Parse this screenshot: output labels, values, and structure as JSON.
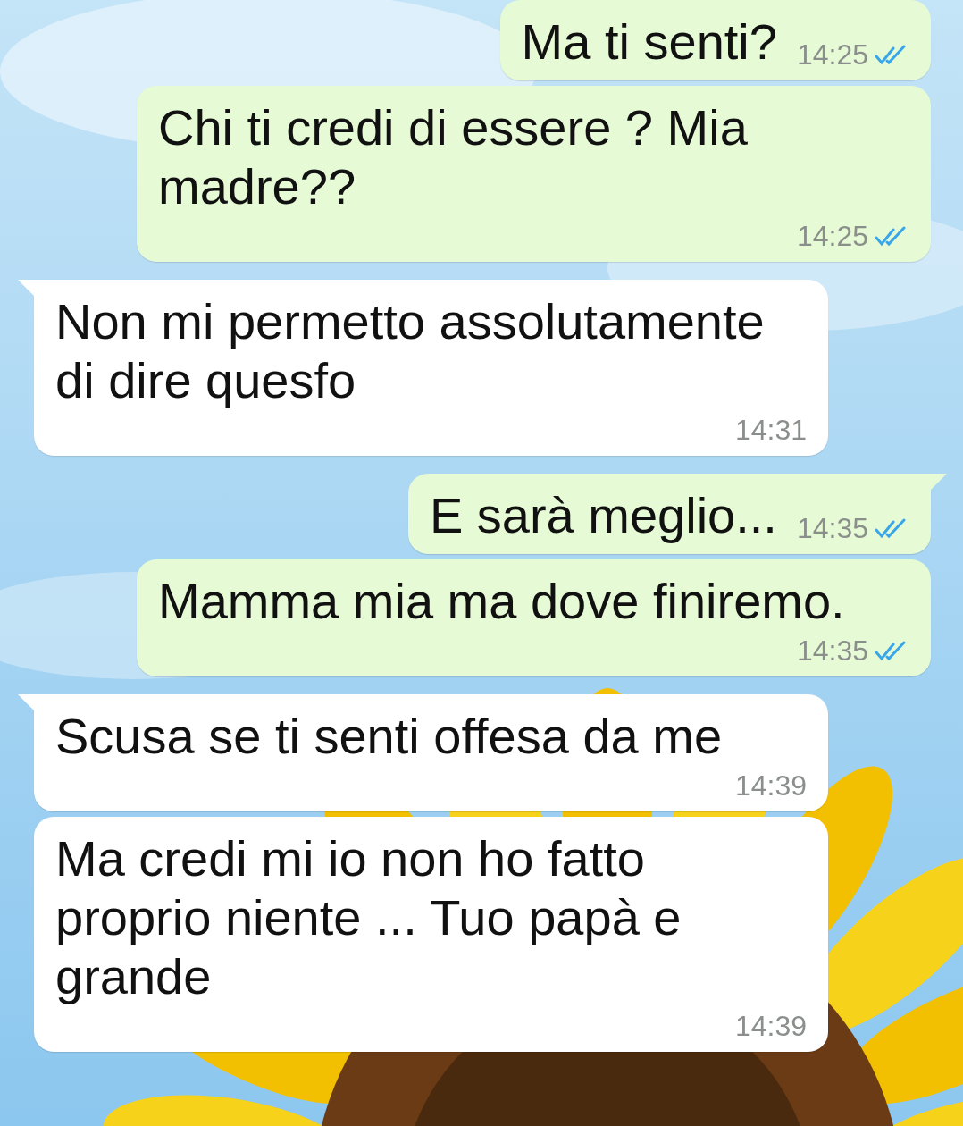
{
  "messages": [
    {
      "kind": "outgoing",
      "text": "Ma ti senti?",
      "time": "14:25",
      "read": true,
      "tail": false
    },
    {
      "kind": "outgoing",
      "text": "Chi ti credi di essere ? Mia madre??",
      "time": "14:25",
      "read": true,
      "tail": false
    },
    {
      "kind": "incoming",
      "text": "Non mi permetto assolutamente di dire quesfo",
      "time": "14:31",
      "tail": true
    },
    {
      "kind": "outgoing",
      "text": "E sarà meglio...",
      "time": "14:35",
      "read": true,
      "tail": true
    },
    {
      "kind": "outgoing",
      "text": "Mamma mia ma dove finiremo.",
      "time": "14:35",
      "read": true,
      "tail": false
    },
    {
      "kind": "incoming",
      "text": "Scusa se ti senti offesa da me",
      "time": "14:39",
      "tail": true
    },
    {
      "kind": "incoming",
      "text": "Ma credi mi io non ho fatto proprio niente ... Tuo papà e grande",
      "time": "14:39",
      "tail": false
    }
  ]
}
